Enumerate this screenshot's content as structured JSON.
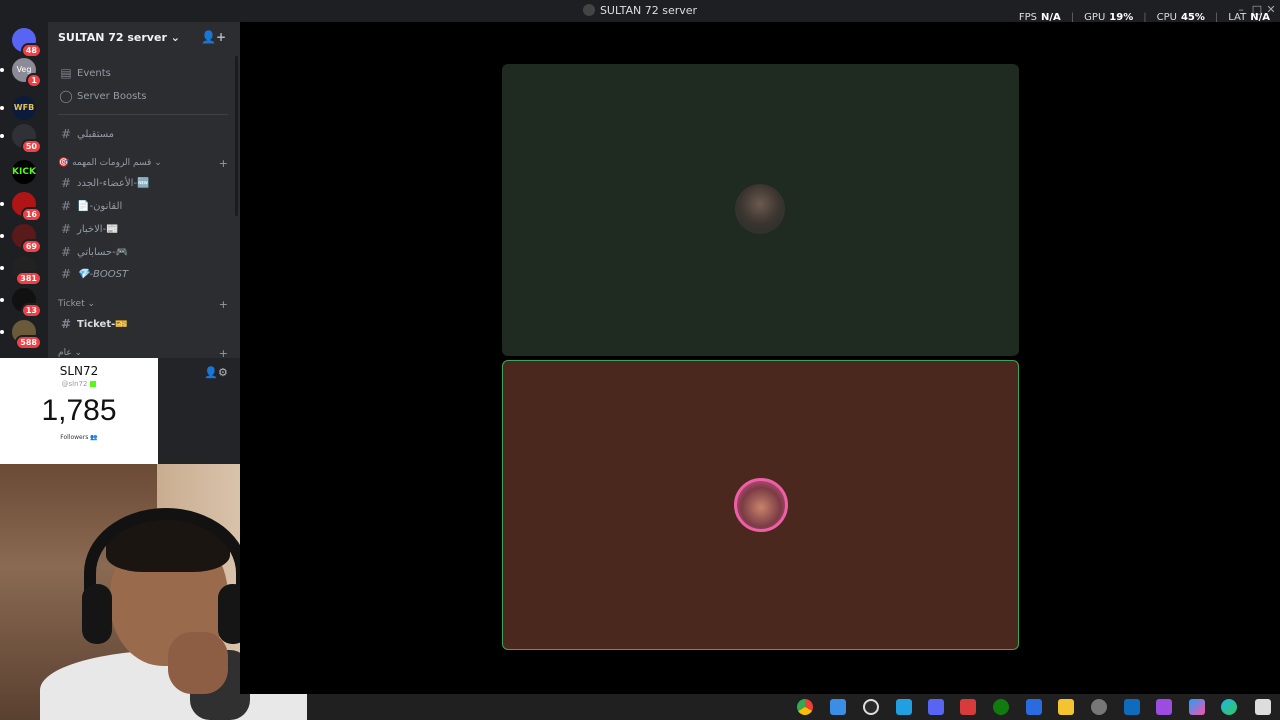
{
  "window": {
    "title": "SULTAN 72 server"
  },
  "perf_overlay": {
    "fps_label": "FPS",
    "fps_value": "N/A",
    "gpu_label": "GPU",
    "gpu_value": "19%",
    "cpu_label": "CPU",
    "cpu_value": "45%",
    "lat_label": "LAT",
    "lat_value": "N/A"
  },
  "guild_badges": [
    "48",
    "1",
    "50",
    "16",
    "69",
    "381",
    "13",
    "588"
  ],
  "guild_text": {
    "vegas": "Veg",
    "wfb": "WFB",
    "kick": "KICK"
  },
  "server": {
    "name": "SULTAN 72 server",
    "events_label": "Events",
    "boosts_label": "Server Boosts"
  },
  "channels": {
    "general_top": "مستقبلي",
    "category_1": "قسم الرومات المهمه",
    "items_1": [
      "الأعضاء-الجدد-🆕",
      "📄-القانون",
      "الاخبار-📰",
      "حساباتي-🎮",
      "💎-BOOST"
    ],
    "category_ticket": "Ticket",
    "ticket": "Ticket-🎫",
    "category_general": "عام"
  },
  "follower_widget": {
    "name": "SLN72",
    "handle": "@sln72",
    "count": "1,785",
    "label": "Followers"
  },
  "colors": {
    "tile_1_bg": "#1f2a21",
    "tile_2_bg": "#4a281e",
    "speaking_border": "#3ba55c",
    "discord_bg": "#2b2d31",
    "kick_green": "#53fc18"
  },
  "taskbar_icons": [
    "chrome-icon",
    "store-icon",
    "obs-icon",
    "file-icon",
    "discord-icon",
    "app-icon",
    "xbox-icon",
    "app2-icon",
    "folder-icon",
    "settings-icon",
    "mail-icon",
    "app3-icon",
    "copilot-icon",
    "edge-icon",
    "windows-icon"
  ]
}
